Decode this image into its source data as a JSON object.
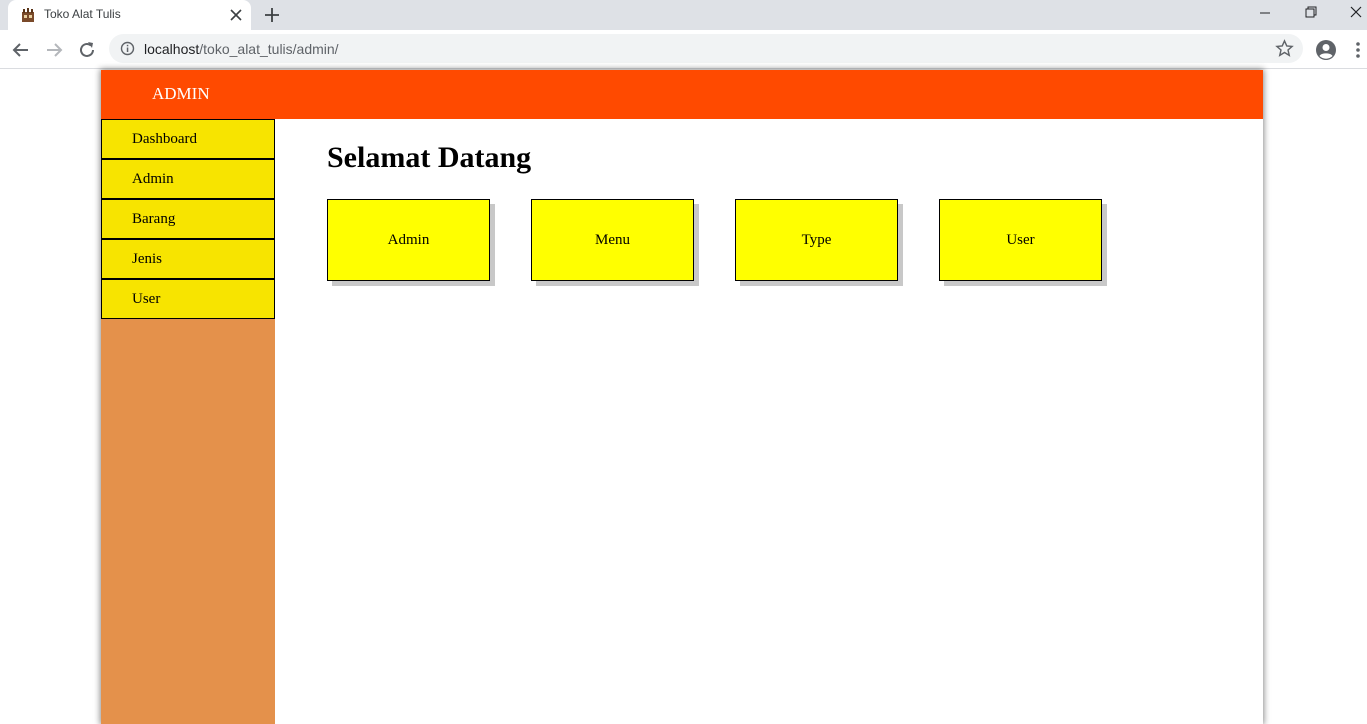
{
  "browser": {
    "tab_title": "Toko Alat Tulis",
    "url_host": "localhost",
    "url_path": "/toko_alat_tulis/admin/"
  },
  "header": {
    "title": "ADMIN",
    "color": "#ff4a00"
  },
  "sidebar": {
    "background": "#e4914b",
    "item_color": "#f7e400",
    "items": [
      {
        "label": "Dashboard"
      },
      {
        "label": "Admin"
      },
      {
        "label": "Barang"
      },
      {
        "label": "Jenis"
      },
      {
        "label": "User"
      }
    ]
  },
  "main": {
    "heading": "Selamat Datang",
    "card_color": "#ffff00",
    "cards": [
      {
        "label": "Admin"
      },
      {
        "label": "Menu"
      },
      {
        "label": "Type"
      },
      {
        "label": "User"
      }
    ]
  }
}
